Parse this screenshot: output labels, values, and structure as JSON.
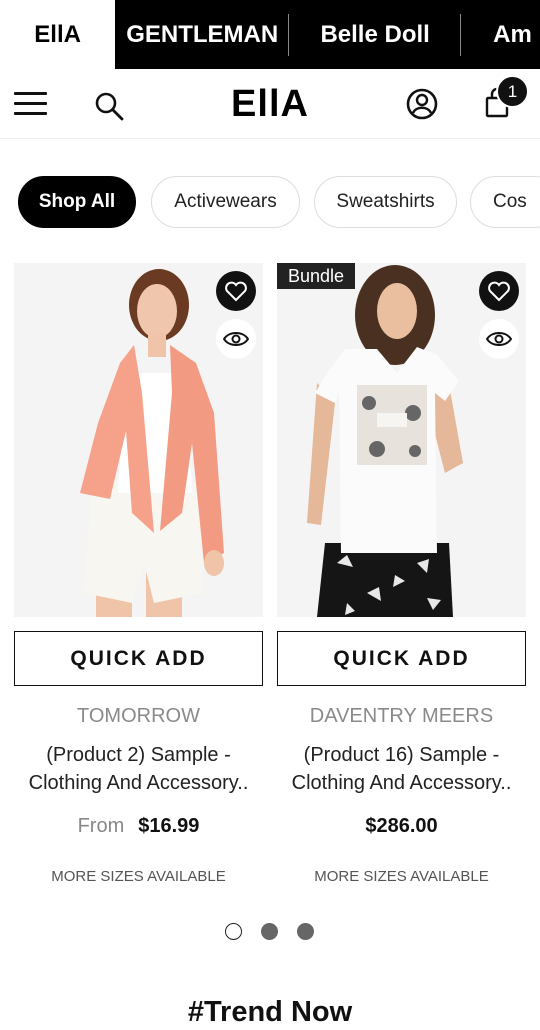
{
  "brand_tabs": [
    {
      "label": "EllA"
    },
    {
      "label": "GENTLEMAN"
    },
    {
      "label": "Belle Doll"
    },
    {
      "label": "Am"
    }
  ],
  "header": {
    "logo": "EllA",
    "cart_count": "1",
    "icons": {
      "menu": "hamburger-icon",
      "search": "search-icon",
      "account": "account-icon",
      "cart": "shopping-bag-icon"
    }
  },
  "categories": [
    {
      "label": "Shop All",
      "active": true
    },
    {
      "label": "Activewears"
    },
    {
      "label": "Sweatshirts"
    },
    {
      "label": "Cos"
    }
  ],
  "products": [
    {
      "badge": "",
      "quick_add": "QUICK ADD",
      "vendor": "TOMORROW",
      "title_line1": "(Product 2) Sample -",
      "title_line2": "Clothing And Accessory..",
      "price_prefix": "From",
      "price": "$16.99",
      "sizes": "MORE SIZES AVAILABLE"
    },
    {
      "badge": "Bundle",
      "quick_add": "QUICK ADD",
      "vendor": "DAVENTRY MEERS",
      "title_line1": "(Product 16) Sample -",
      "title_line2": "Clothing And Accessory..",
      "price_prefix": "",
      "price": "$286.00",
      "sizes": "MORE SIZES AVAILABLE"
    }
  ],
  "pagination": {
    "current": 1,
    "total": 3
  },
  "section_title": "#Trend Now",
  "colors": {
    "brand_black": "#000000",
    "chip_active": "#000000",
    "vendor_grey": "#8a8a8a"
  }
}
